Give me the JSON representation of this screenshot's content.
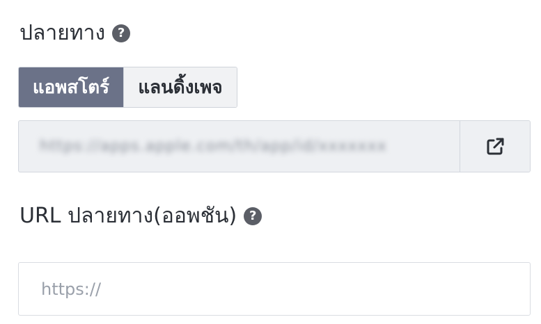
{
  "destination": {
    "label": "ปลายทาง",
    "help_icon": "question-circle-icon",
    "toggle": {
      "options": [
        "แอพสโตร์",
        "แลนดิ้งเพจ"
      ],
      "selected": "แอพสโตร์"
    },
    "url_value": "https://apps.apple.com/th/app/id/xxxxxxx",
    "open_link_icon": "external-link-icon"
  },
  "destination_url": {
    "label": "URL ปลายทาง(ออพชัน)",
    "help_icon": "question-circle-icon",
    "placeholder": "https://",
    "value": ""
  },
  "colors": {
    "toggle_active_bg": "#6b7288",
    "toggle_inactive_bg": "#f1f2f4",
    "readonly_field_bg": "#eef0f3",
    "help_icon_bg": "#5b5e66"
  }
}
